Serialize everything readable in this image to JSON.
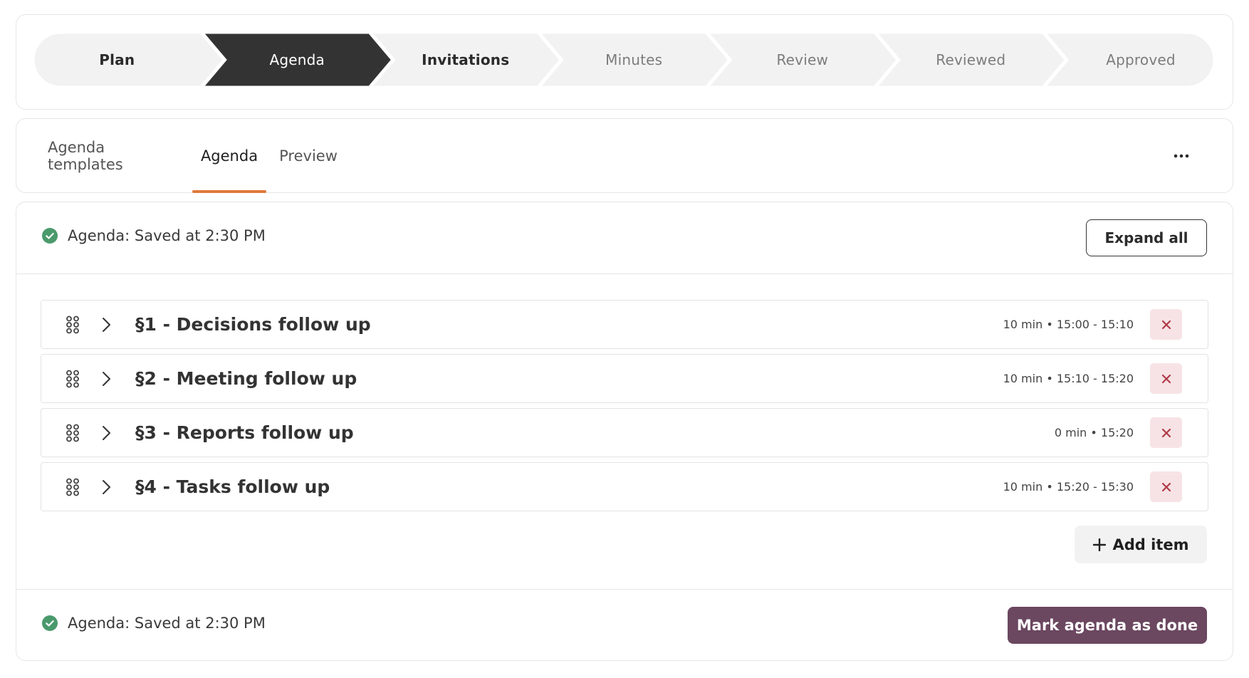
{
  "colors": {
    "active_step": "#333333",
    "inactive_step": "#f2f2f2",
    "tab_underline": "#e07a3b",
    "success": "#4a9a6c",
    "delete_bg": "#f7e3e5",
    "delete_icon": "#b03a48",
    "primary_button": "#6b4760"
  },
  "stepper": {
    "steps": [
      {
        "label": "Plan",
        "state": "done"
      },
      {
        "label": "Agenda",
        "state": "active"
      },
      {
        "label": "Invitations",
        "state": "done"
      },
      {
        "label": "Minutes",
        "state": "todo"
      },
      {
        "label": "Review",
        "state": "todo"
      },
      {
        "label": "Reviewed",
        "state": "todo"
      },
      {
        "label": "Approved",
        "state": "todo"
      }
    ]
  },
  "tabs": {
    "items": [
      {
        "label": "Agenda templates",
        "active": false
      },
      {
        "label": "Agenda",
        "active": true
      },
      {
        "label": "Preview",
        "active": false
      }
    ],
    "more_label": "•••"
  },
  "agenda": {
    "status_top": "Agenda: Saved at 2:30 PM",
    "expand_label": "Expand all",
    "items": [
      {
        "title": "§1 - Decisions follow up",
        "time": "10 min • 15:00 - 15:10"
      },
      {
        "title": "§2 - Meeting follow up",
        "time": "10 min • 15:10 - 15:20"
      },
      {
        "title": "§3 - Reports follow up",
        "time": "0 min • 15:20"
      },
      {
        "title": "§4 - Tasks follow up",
        "time": "10 min • 15:20 - 15:30"
      }
    ],
    "add_label": "Add item",
    "status_bottom": "Agenda: Saved at 2:30 PM",
    "done_label": "Mark agenda as done"
  },
  "icons": {
    "status": "check-circle-icon",
    "drag": "drag-handle-icon",
    "expand_row": "chevron-right-icon",
    "delete": "close-icon",
    "add": "plus-icon",
    "more": "more-horizontal-icon"
  }
}
